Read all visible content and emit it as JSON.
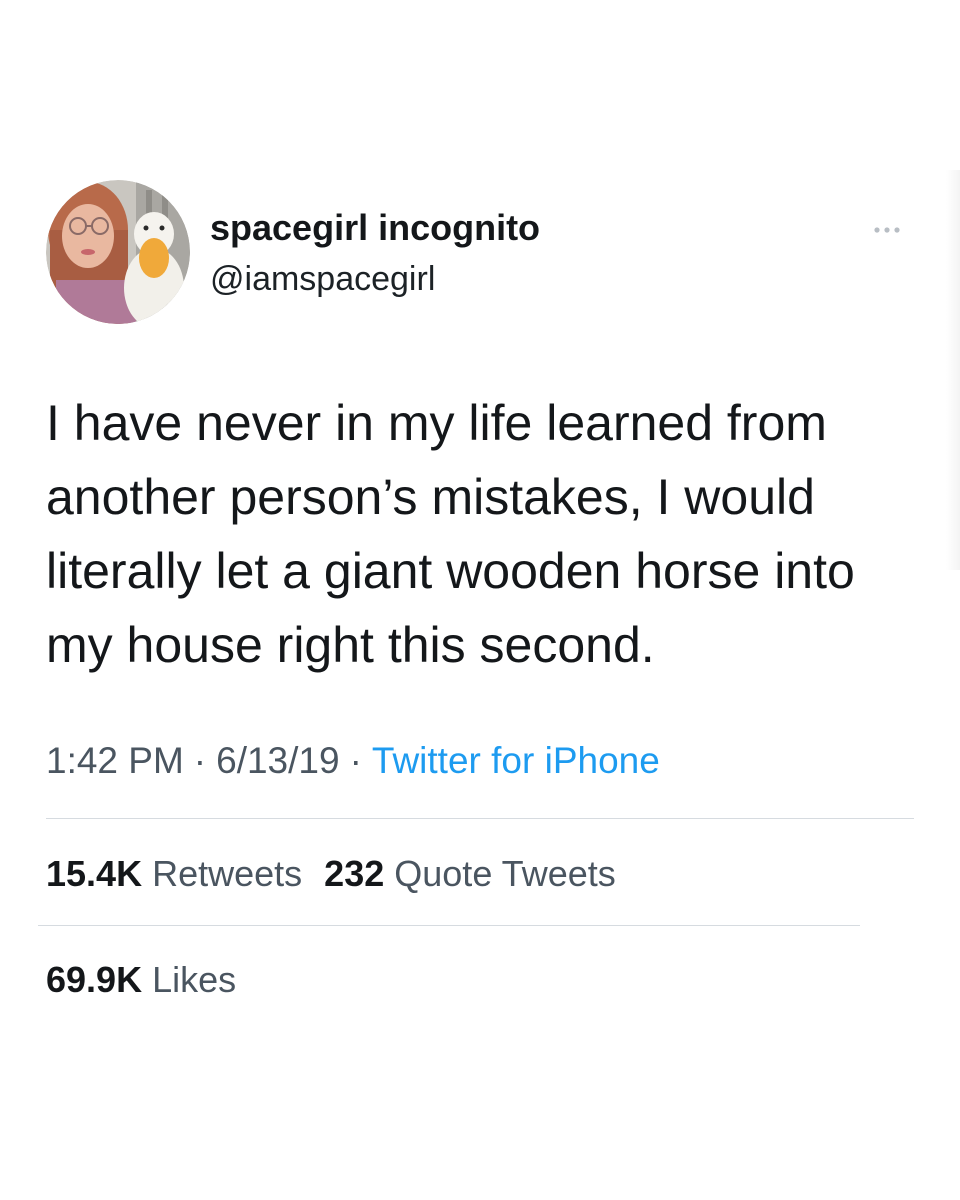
{
  "tweet": {
    "author": {
      "display_name": "spacegirl incognito",
      "handle": "@iamspacegirl",
      "avatar_icon": "avatar-photo"
    },
    "more_icon": "more-options-icon",
    "text": "I have never in my life learned from another person’s mistakes, I would literally let a giant wooden horse into my house right this second.",
    "time": "1:42 PM",
    "date": "6/13/19",
    "separator": "·",
    "source": "Twitter for iPhone",
    "stats": {
      "retweets_count": "15.4K",
      "retweets_label": "Retweets",
      "quote_tweets_count": "232",
      "quote_tweets_label": "Quote Tweets",
      "likes_count": "69.9K",
      "likes_label": "Likes"
    }
  },
  "colors": {
    "text_primary": "#14171a",
    "text_secondary": "#4a5560",
    "link": "#1d9bf0",
    "divider": "#d6dbe0",
    "background": "#ffffff"
  }
}
